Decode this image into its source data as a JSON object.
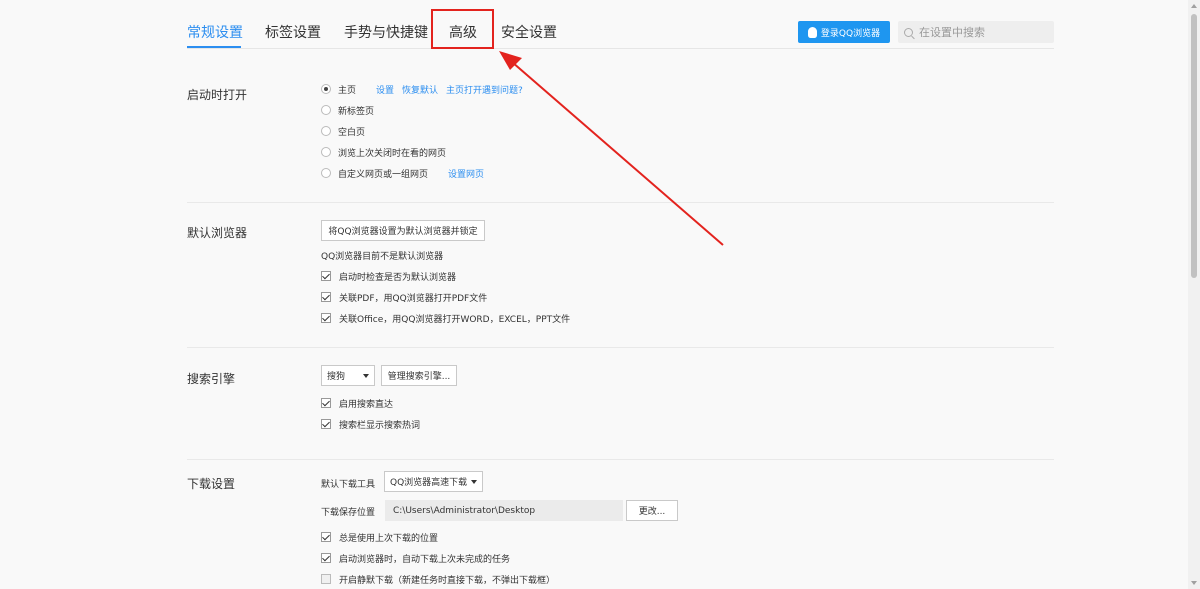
{
  "header": {
    "tabs": [
      {
        "label": "常规设置",
        "active": true
      },
      {
        "label": "标签设置",
        "active": false
      },
      {
        "label": "手势与快捷键",
        "active": false
      },
      {
        "label": "高级",
        "active": false
      },
      {
        "label": "安全设置",
        "active": false
      }
    ],
    "login_label": "登录QQ浏览器",
    "search_placeholder": "在设置中搜索"
  },
  "startup": {
    "title": "启动时打开",
    "options": [
      {
        "label": "主页",
        "checked": true,
        "links": [
          "设置",
          "恢复默认",
          "主页打开遇到问题?"
        ]
      },
      {
        "label": "新标签页",
        "checked": false
      },
      {
        "label": "空白页",
        "checked": false
      },
      {
        "label": "浏览上次关闭时在看的网页",
        "checked": false
      },
      {
        "label": "自定义网页或一组网页",
        "checked": false,
        "links": [
          "设置网页"
        ]
      }
    ]
  },
  "default_browser": {
    "title": "默认浏览器",
    "set_default_button": "将QQ浏览器设置为默认浏览器并锁定",
    "status_text": "QQ浏览器目前不是默认浏览器",
    "checkboxes": [
      {
        "label": "启动时检查是否为默认浏览器",
        "checked": true
      },
      {
        "label": "关联PDF，用QQ浏览器打开PDF文件",
        "checked": true
      },
      {
        "label": "关联Office，用QQ浏览器打开WORD，EXCEL，PPT文件",
        "checked": true
      }
    ]
  },
  "search_engine": {
    "title": "搜索引擎",
    "selected_engine": "搜狗",
    "manage_button": "管理搜索引擎...",
    "checkboxes": [
      {
        "label": "启用搜索直达",
        "checked": true
      },
      {
        "label": "搜索栏显示搜索热词",
        "checked": true
      }
    ]
  },
  "download": {
    "title": "下载设置",
    "tool_label": "默认下载工具",
    "tool_selected": "QQ浏览器高速下载",
    "path_label": "下载保存位置",
    "path_value": "C:\\Users\\Administrator\\Desktop",
    "change_button": "更改...",
    "checkboxes": [
      {
        "label": "总是使用上次下载的位置",
        "checked": true
      },
      {
        "label": "启动浏览器时，自动下载上次未完成的任务",
        "checked": true
      },
      {
        "label": "开启静默下载（新建任务时直接下载，不弹出下载框）",
        "checked": false
      }
    ]
  },
  "colors": {
    "accent": "#2c8ef0",
    "annotation_red": "#e3231e"
  }
}
